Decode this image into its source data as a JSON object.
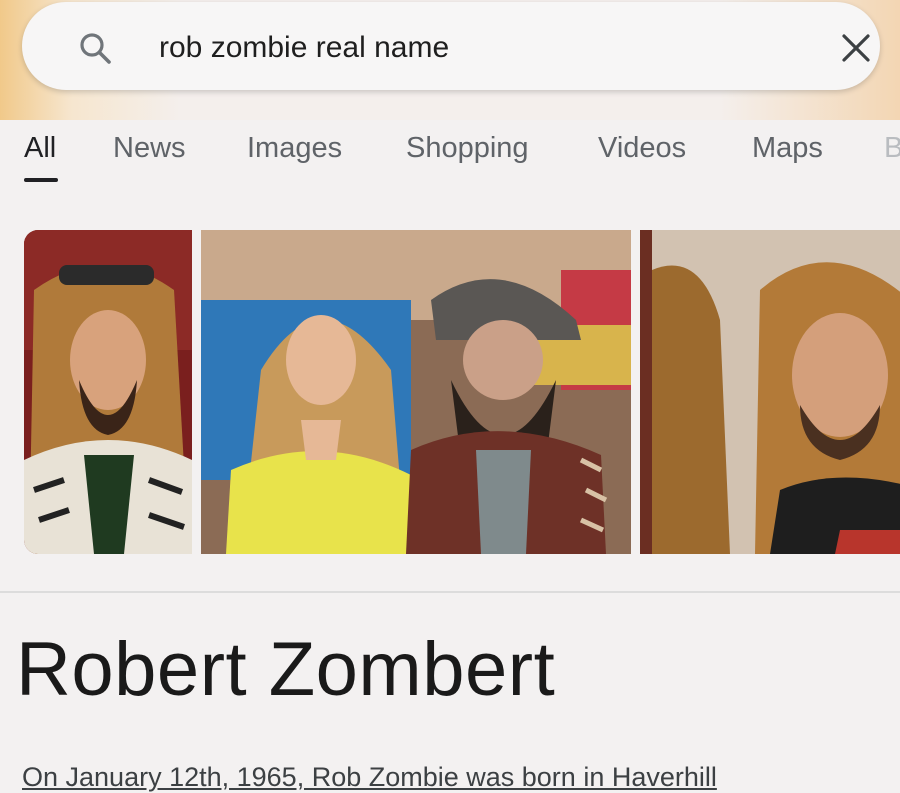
{
  "search": {
    "query": "rob zombie real name"
  },
  "tabs": [
    {
      "label": "All",
      "active": true
    },
    {
      "label": "News"
    },
    {
      "label": "Images"
    },
    {
      "label": "Shopping"
    },
    {
      "label": "Videos"
    },
    {
      "label": "Maps"
    },
    {
      "label": "B"
    }
  ],
  "images": [
    {
      "name": "image-result-1"
    },
    {
      "name": "image-result-2"
    },
    {
      "name": "image-result-3"
    }
  ],
  "answer": {
    "title": "Robert Zombert",
    "snippet": "On January 12th, 1965, Rob Zombie was born in Haverhill"
  },
  "icons": {
    "search": "search-icon",
    "clear": "close-icon"
  }
}
